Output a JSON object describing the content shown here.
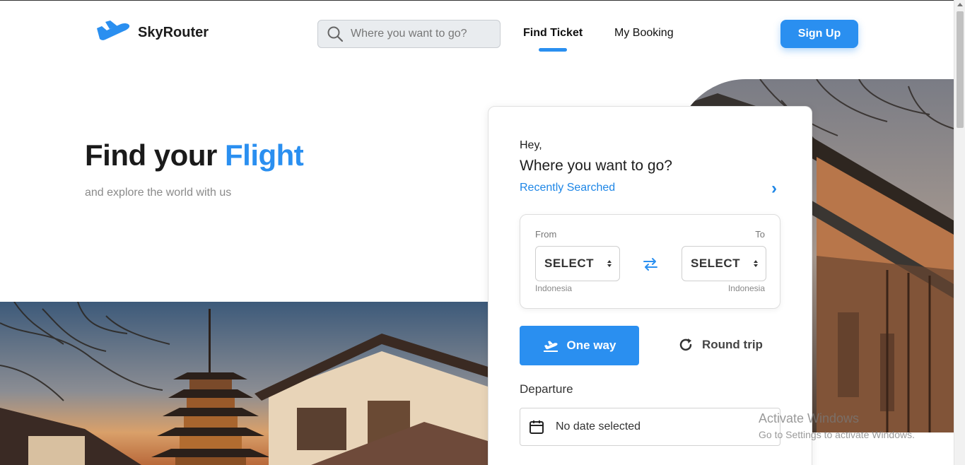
{
  "header": {
    "brand": "SkyRouter",
    "search_placeholder": "Where you want to go?",
    "nav": {
      "find_ticket": "Find Ticket",
      "my_booking": "My Booking"
    },
    "signup_label": "Sign Up"
  },
  "hero": {
    "title_prefix": "Find your",
    "title_accent": "Flight",
    "subtitle": "and explore the world with us"
  },
  "booking_card": {
    "greeting": "Hey,",
    "question": "Where you want to go?",
    "recent_label": "Recently Searched",
    "from_label": "From",
    "to_label": "To",
    "from_select": "SELECT",
    "to_select": "SELECT",
    "from_country": "Indonesia",
    "to_country": "Indonesia",
    "one_way_label": "One way",
    "round_trip_label": "Round trip",
    "departure_label": "Departure",
    "date_value": "No date selected"
  },
  "watermark": {
    "title": "Activate Windows",
    "subtitle": "Go to Settings to activate Windows."
  },
  "colors": {
    "accent": "#2a8ff0",
    "link": "#1e86e6",
    "text": "#1d1d1d"
  }
}
